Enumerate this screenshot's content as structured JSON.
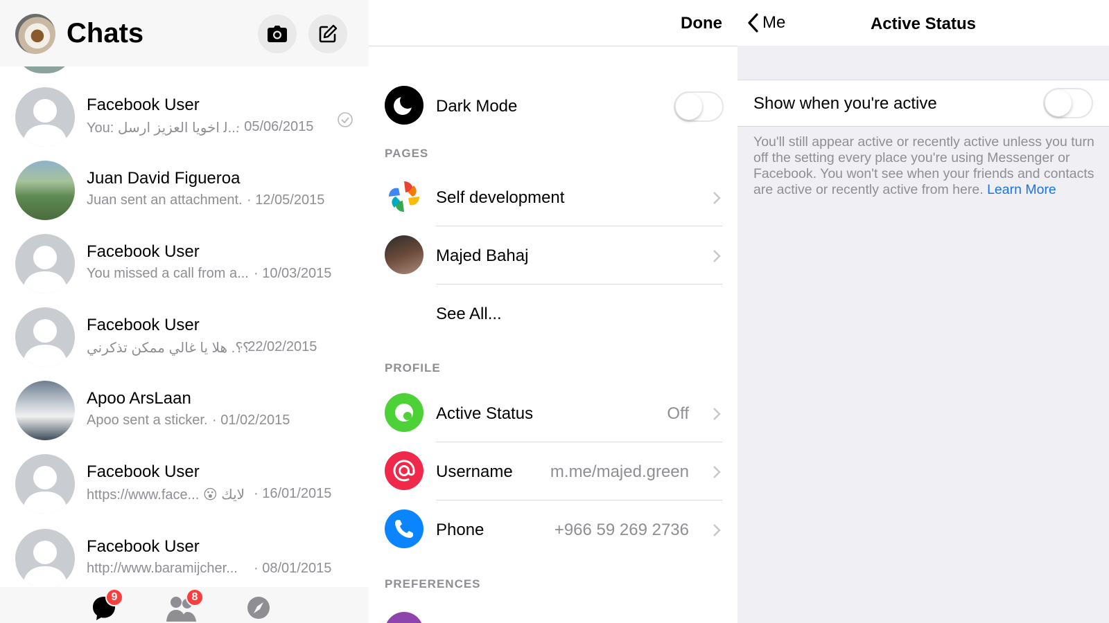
{
  "chats": {
    "title": "Chats",
    "rows": [
      {
        "name": "Facebook User",
        "preview": "You: ﻟ اخويا العزيز ارسل...",
        "date": "· 05/06/2015"
      },
      {
        "name": "Juan David Figueroa",
        "preview": "Juan sent an attachment.",
        "date": "· 12/05/2015"
      },
      {
        "name": "Facebook User",
        "preview": "You missed a call from a...",
        "date": "· 10/03/2015"
      },
      {
        "name": "Facebook User",
        "preview": "؟؟. هلا يا غالي ممكن تذكرني",
        "date": "· 22/02/2015"
      },
      {
        "name": "Apoo ArsLaan",
        "preview": "Apoo sent a sticker.",
        "date": "· 01/02/2015"
      },
      {
        "name": "Facebook User",
        "preview": "https://www.face... 😮 لايك",
        "date": "· 16/01/2015"
      },
      {
        "name": "Facebook User",
        "preview": "http://www.baramijcher...",
        "date": "· 08/01/2015"
      }
    ],
    "tabbar": {
      "chats_badge": "9",
      "people_badge": "8"
    }
  },
  "settings": {
    "done_label": "Done",
    "dark_mode_label": "Dark Mode",
    "pages_header": "PAGES",
    "pages": [
      {
        "label": "Self development"
      },
      {
        "label": "Majed Bahaj"
      }
    ],
    "see_all_label": "See All...",
    "profile_header": "PROFILE",
    "active_status": {
      "label": "Active Status",
      "value": "Off"
    },
    "username": {
      "label": "Username",
      "value": "m.me/majed.green"
    },
    "phone": {
      "label": "Phone",
      "value": "+966 59 269 2736"
    },
    "preferences_header": "PREFERENCES",
    "colors": {
      "active_green": "#4cd137",
      "username_red": "#f02849",
      "phone_blue": "#0a84ff"
    }
  },
  "active_status": {
    "back_label": "Me",
    "title": "Active Status",
    "show_active_label": "Show when you're active",
    "show_active_on": false,
    "footnote": "You'll still appear active or recently active unless you turn off the setting every place you're using Messenger or Facebook. You won't see when your friends and contacts are active or recently active from here.",
    "learn_more": "Learn More"
  }
}
